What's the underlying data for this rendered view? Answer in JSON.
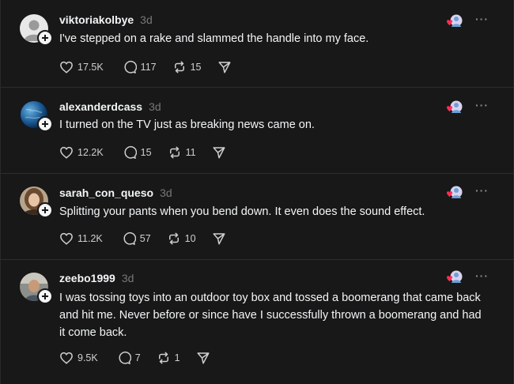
{
  "posts": [
    {
      "username": "viktoriakolbye",
      "time": "3d",
      "text": "I've stepped on a rake and slammed the handle into my face.",
      "likes": "17.5K",
      "replies": "117",
      "reposts": "15",
      "avatar_type": "default-avatar"
    },
    {
      "username": "alexanderdcass",
      "time": "3d",
      "text": "I turned on the TV just as breaking news came on.",
      "likes": "12.2K",
      "replies": "15",
      "reposts": "11",
      "avatar_type": "globe-avatar"
    },
    {
      "username": "sarah_con_queso",
      "time": "3d",
      "text": "Splitting your pants when you bend down. It even does the sound effect.",
      "likes": "11.2K",
      "replies": "57",
      "reposts": "10",
      "avatar_type": "photo-avatar"
    },
    {
      "username": "zeebo1999",
      "time": "3d",
      "text": "I was tossing toys into an outdoor toy box and tossed a boomerang that came back and hit me. Never before or since have I successfully thrown a boomerang and had it come back.",
      "likes": "9.5K",
      "replies": "7",
      "reposts": "1",
      "avatar_type": "photo-avatar"
    }
  ],
  "icons": {
    "like": "heart-icon",
    "reply": "comment-icon",
    "repost": "repost-icon",
    "share": "share-icon",
    "more": "more-icon",
    "follow": "plus-icon",
    "reaction": "reaction-icon"
  },
  "more_label": "···",
  "colors": {
    "background": "#181818",
    "text": "#f3f5f7",
    "muted": "#777777",
    "divider": "#2d2d2d"
  }
}
